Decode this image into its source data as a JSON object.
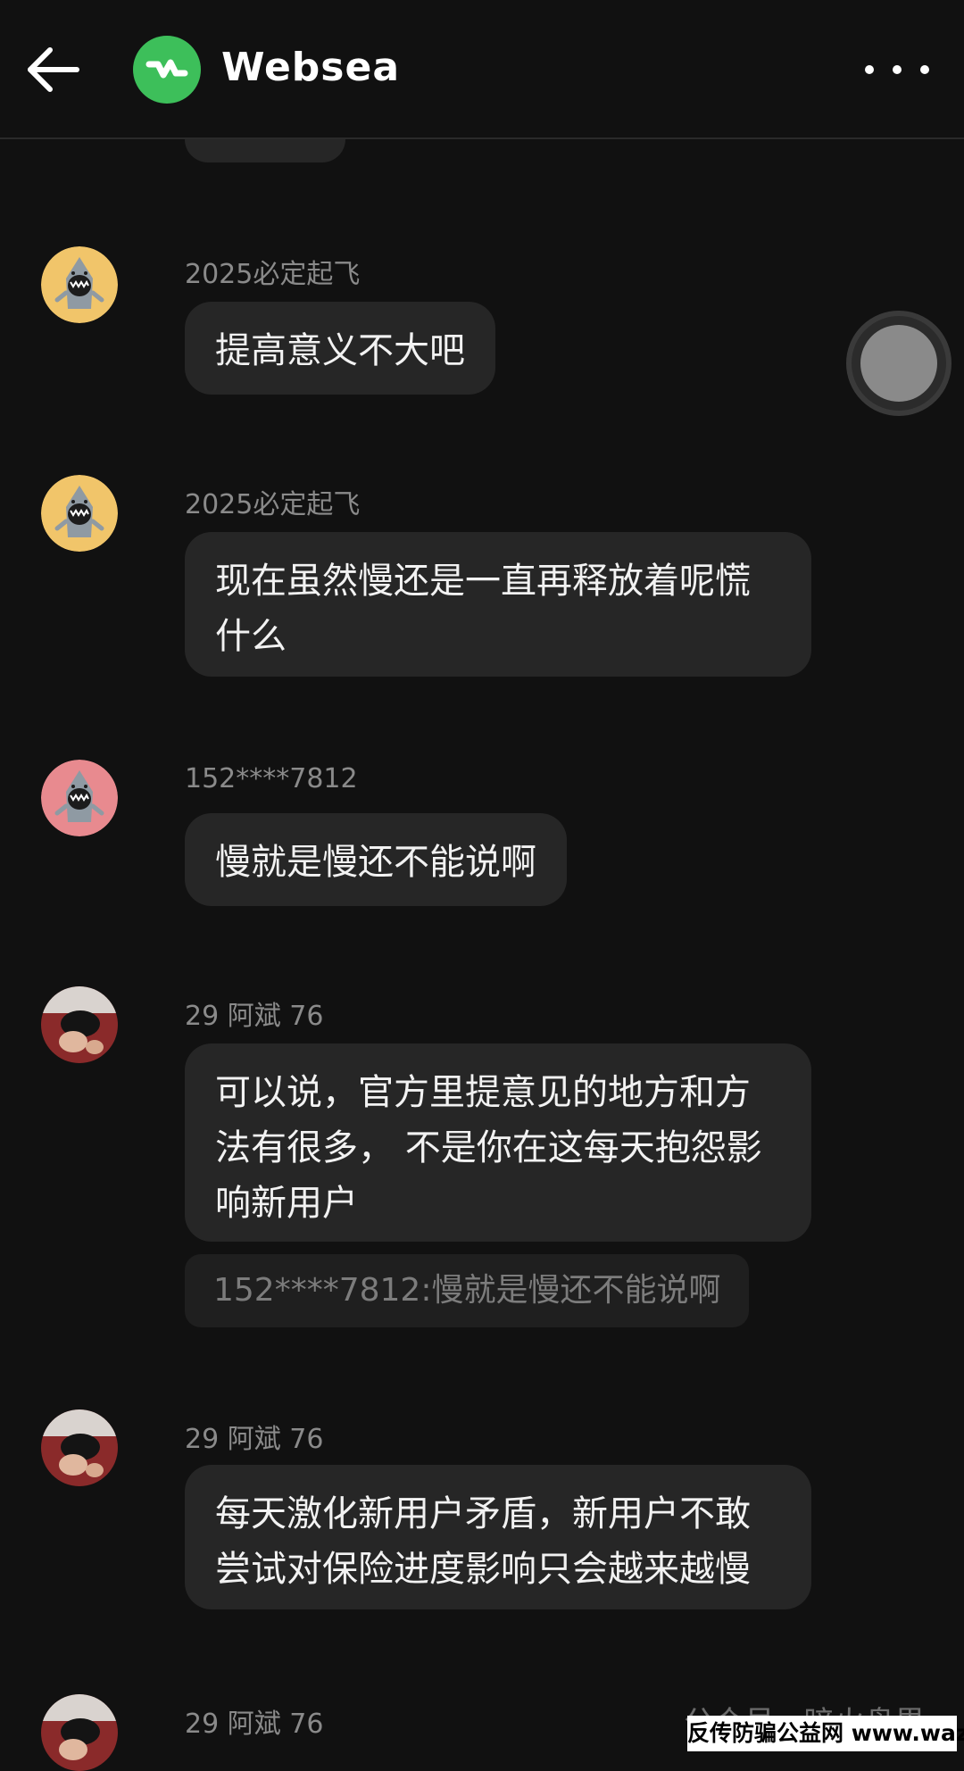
{
  "header": {
    "back_icon": "arrow-left-icon",
    "logo_icon": "websea-logo",
    "title": "Websea",
    "more_icon": "more-horizontal-icon",
    "logo_color": "#3dbf5a"
  },
  "messages": [
    {
      "sender": "2025必定起飞",
      "avatar": "shark-avatar-yellow",
      "text": "提高意义不大吧"
    },
    {
      "sender": "2025必定起飞",
      "avatar": "shark-avatar-yellow",
      "text_lines": [
        "现在虽然慢还是一直再释放着呢慌",
        "什么"
      ]
    },
    {
      "sender": "152****7812",
      "avatar": "shark-avatar-pink",
      "text": "慢就是慢还不能说啊"
    },
    {
      "sender": "29 阿斌 76",
      "avatar": "photo-avatar",
      "text_lines": [
        "可以说，官方里提意见的地方和方",
        "法有很多，  不是你在这每天抱怨影",
        "响新用户"
      ],
      "quote": "152****7812:慢就是慢还不能说啊"
    },
    {
      "sender": "29 阿斌 76",
      "avatar": "photo-avatar",
      "text_lines": [
        "每天激化新用户矛盾，新用户不敢",
        "尝试对保险进度影响只会越来越慢"
      ]
    },
    {
      "sender": "29 阿斌 76",
      "avatar": "photo-avatar"
    }
  ],
  "floating_button_icon": "floating-assistive-button",
  "watermarks": {
    "top": "公众号 · 暗火盘界",
    "bottom": "反传防骗公益网 www.wazi.cc"
  },
  "colors": {
    "background": "#111111",
    "bubble": "#262626",
    "sender_text": "#8a8a8a",
    "avatar_yellow": "#f1c56a",
    "avatar_pink": "#e88a8f"
  }
}
